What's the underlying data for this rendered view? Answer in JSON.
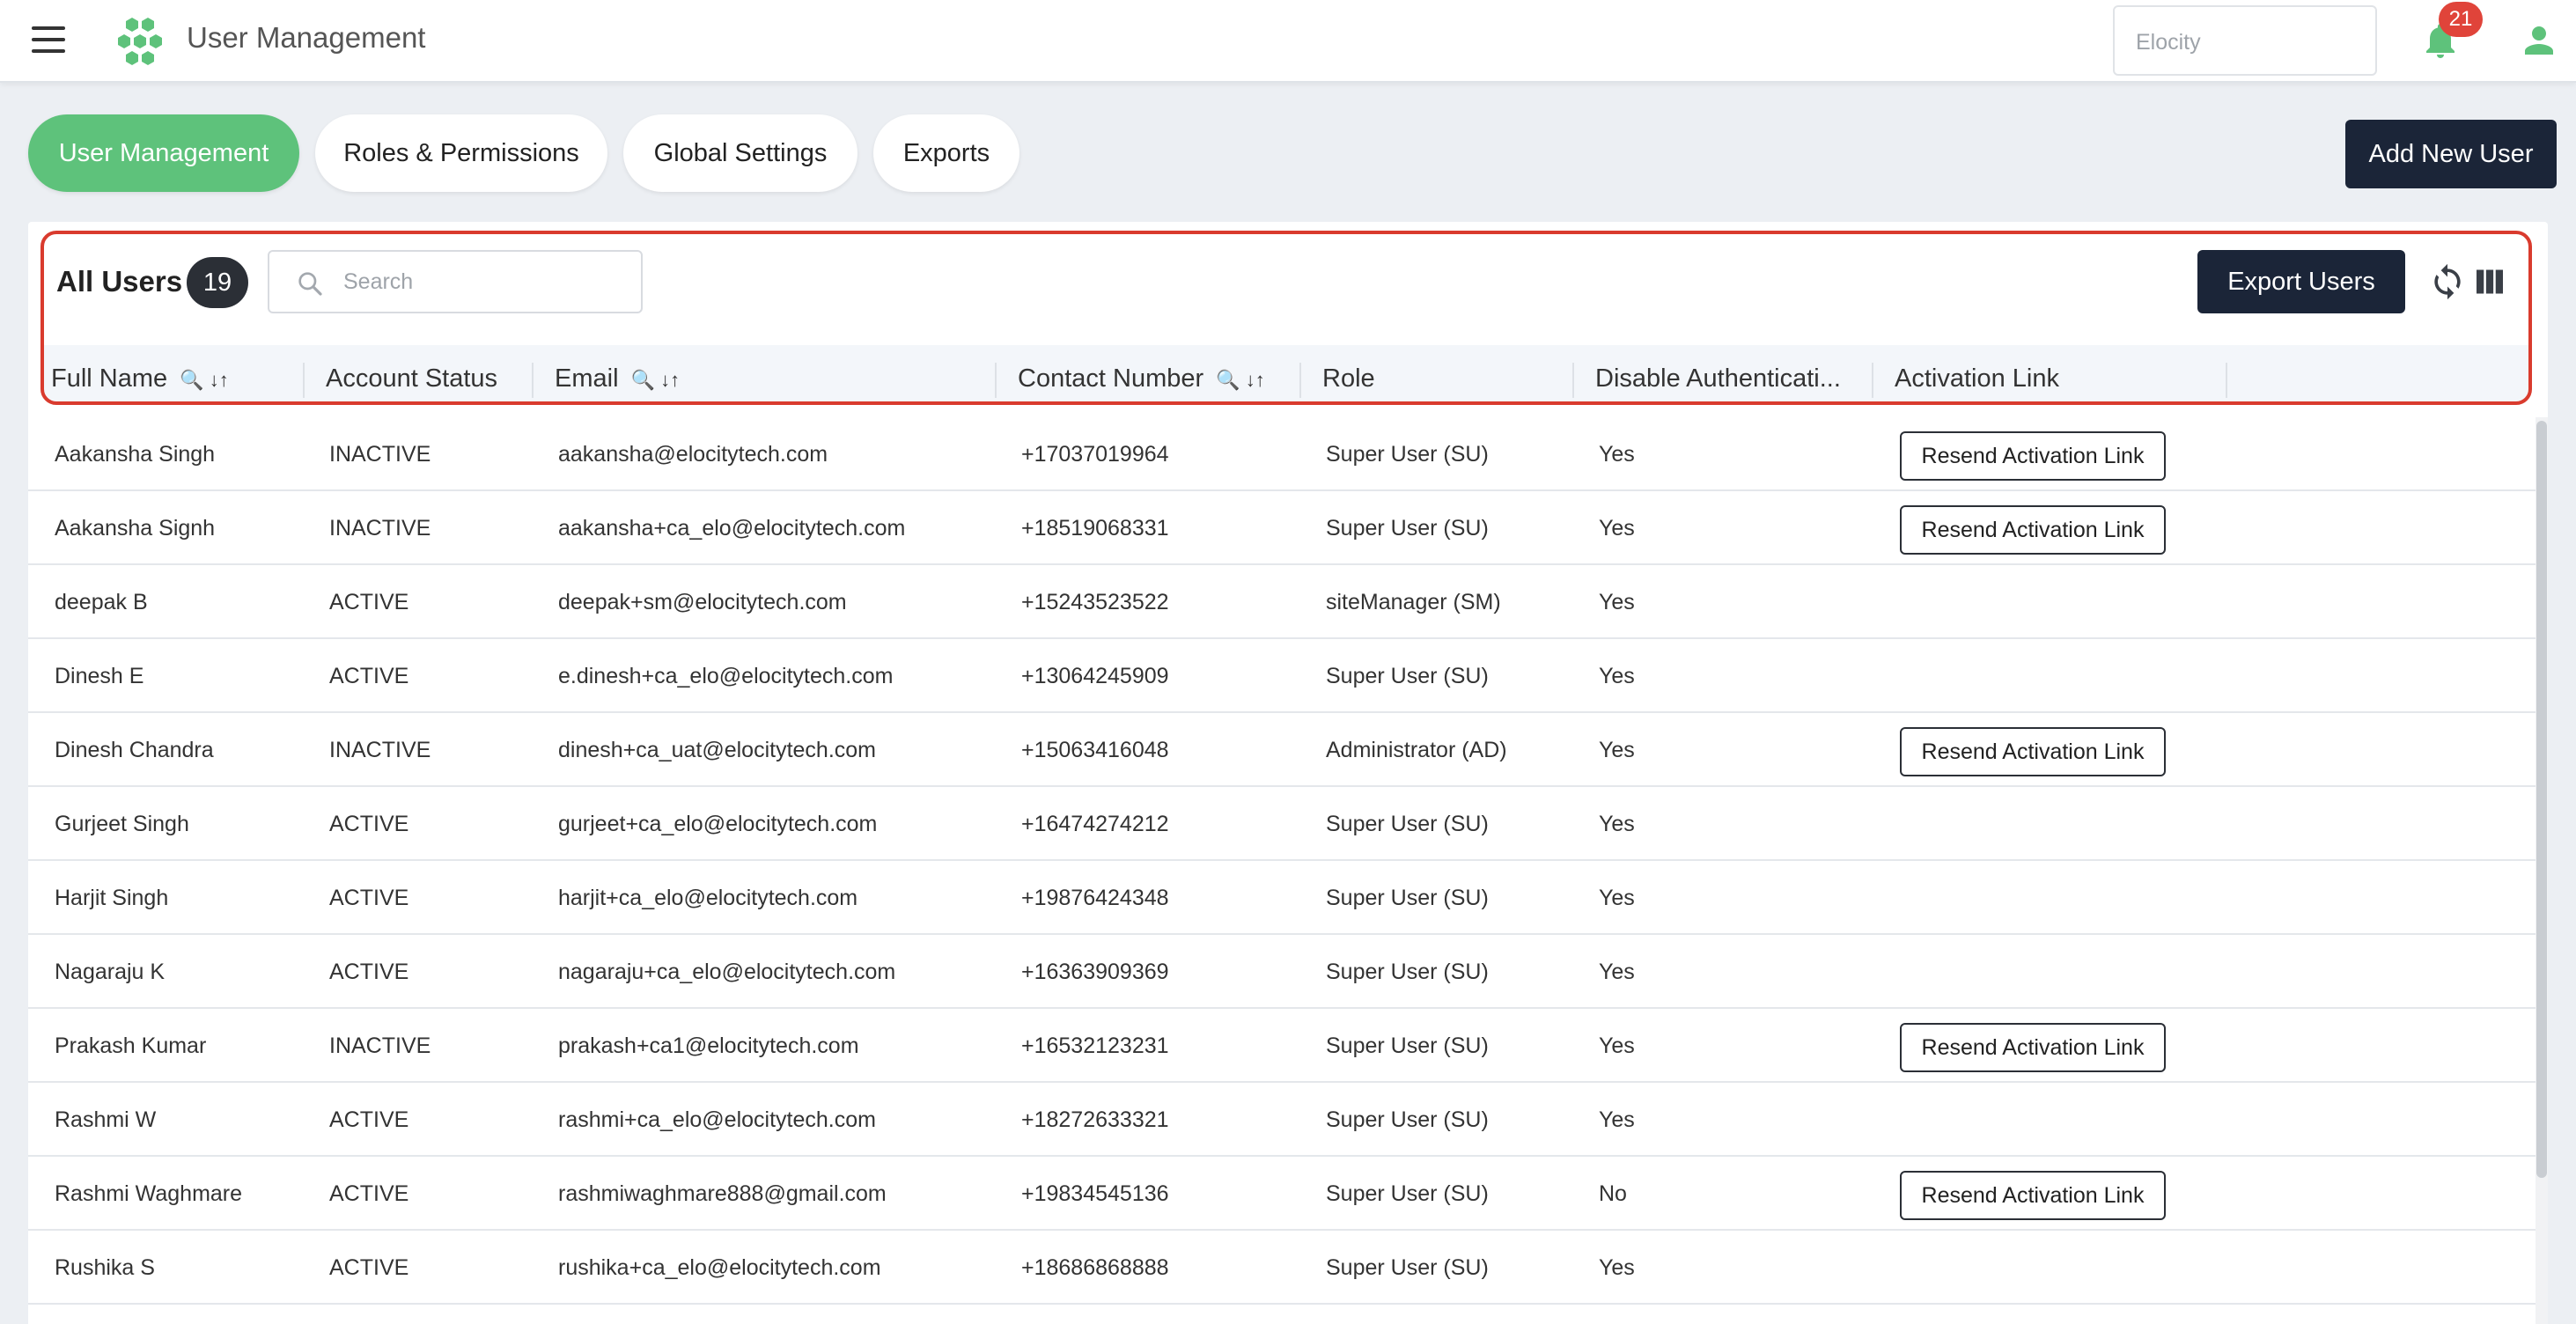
{
  "header": {
    "title": "User Management",
    "site_selector": "Elocity",
    "notification_count": "21",
    "brand_color": "#5ec27b"
  },
  "tabs": [
    {
      "label": "User Management",
      "active": true
    },
    {
      "label": "Roles & Permissions",
      "active": false
    },
    {
      "label": "Global Settings",
      "active": false
    },
    {
      "label": "Exports",
      "active": false
    }
  ],
  "actions": {
    "add_user": "Add New User",
    "export_users": "Export Users"
  },
  "list": {
    "title": "All Users",
    "count": "19",
    "search_placeholder": "Search"
  },
  "columns": [
    {
      "label": "Full Name",
      "searchable": true,
      "sortable": true
    },
    {
      "label": "Account Status",
      "searchable": false,
      "sortable": false
    },
    {
      "label": "Email",
      "searchable": true,
      "sortable": true
    },
    {
      "label": "Contact Number",
      "searchable": true,
      "sortable": true
    },
    {
      "label": "Role",
      "searchable": false,
      "sortable": false
    },
    {
      "label": "Disable Authenticati...",
      "searchable": false,
      "sortable": false
    },
    {
      "label": "Activation Link",
      "searchable": false,
      "sortable": false
    }
  ],
  "resend_label": "Resend Activation Link",
  "rows": [
    {
      "name": "Aakansha Singh",
      "status": "INACTIVE",
      "email": "aakansha@elocitytech.com",
      "phone": "+17037019964",
      "role": "Super User (SU)",
      "disable_auth": "Yes",
      "resend": true
    },
    {
      "name": "Aakansha Signh",
      "status": "INACTIVE",
      "email": "aakansha+ca_elo@elocitytech.com",
      "phone": "+18519068331",
      "role": "Super User (SU)",
      "disable_auth": "Yes",
      "resend": true
    },
    {
      "name": "deepak B",
      "status": "ACTIVE",
      "email": "deepak+sm@elocitytech.com",
      "phone": "+15243523522",
      "role": "siteManager (SM)",
      "disable_auth": "Yes",
      "resend": false
    },
    {
      "name": "Dinesh E",
      "status": "ACTIVE",
      "email": "e.dinesh+ca_elo@elocitytech.com",
      "phone": "+13064245909",
      "role": "Super User (SU)",
      "disable_auth": "Yes",
      "resend": false
    },
    {
      "name": "Dinesh Chandra",
      "status": "INACTIVE",
      "email": "dinesh+ca_uat@elocitytech.com",
      "phone": "+15063416048",
      "role": "Administrator (AD)",
      "disable_auth": "Yes",
      "resend": true
    },
    {
      "name": "Gurjeet Singh",
      "status": "ACTIVE",
      "email": "gurjeet+ca_elo@elocitytech.com",
      "phone": "+16474274212",
      "role": "Super User (SU)",
      "disable_auth": "Yes",
      "resend": false
    },
    {
      "name": "Harjit Singh",
      "status": "ACTIVE",
      "email": "harjit+ca_elo@elocitytech.com",
      "phone": "+19876424348",
      "role": "Super User (SU)",
      "disable_auth": "Yes",
      "resend": false
    },
    {
      "name": "Nagaraju K",
      "status": "ACTIVE",
      "email": "nagaraju+ca_elo@elocitytech.com",
      "phone": "+16363909369",
      "role": "Super User (SU)",
      "disable_auth": "Yes",
      "resend": false
    },
    {
      "name": "Prakash Kumar",
      "status": "INACTIVE",
      "email": "prakash+ca1@elocitytech.com",
      "phone": "+16532123231",
      "role": "Super User (SU)",
      "disable_auth": "Yes",
      "resend": true
    },
    {
      "name": "Rashmi W",
      "status": "ACTIVE",
      "email": "rashmi+ca_elo@elocitytech.com",
      "phone": "+18272633321",
      "role": "Super User (SU)",
      "disable_auth": "Yes",
      "resend": false
    },
    {
      "name": "Rashmi Waghmare",
      "status": "ACTIVE",
      "email": "rashmiwaghmare888@gmail.com",
      "phone": "+19834545136",
      "role": "Super User (SU)",
      "disable_auth": "No",
      "resend": true
    },
    {
      "name": "Rushika S",
      "status": "ACTIVE",
      "email": "rushika+ca_elo@elocitytech.com",
      "phone": "+18686868888",
      "role": "Super User (SU)",
      "disable_auth": "Yes",
      "resend": false
    }
  ]
}
